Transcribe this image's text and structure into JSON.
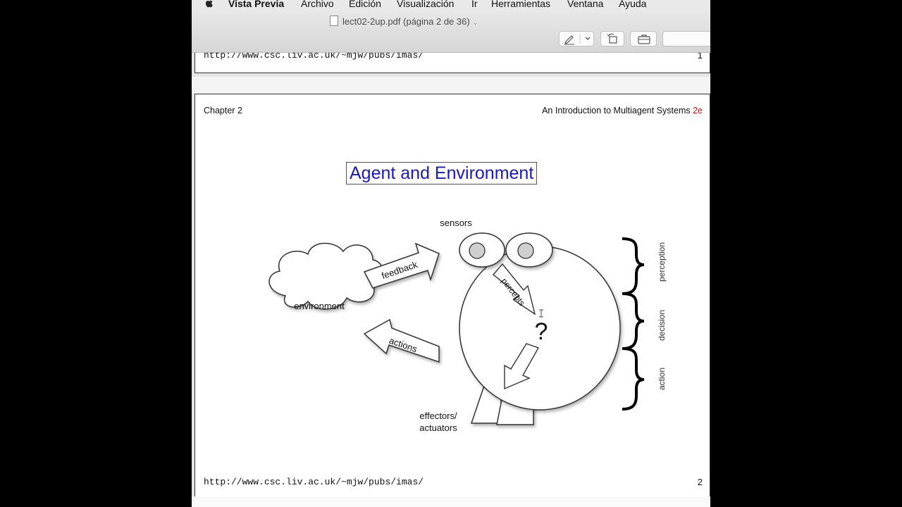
{
  "menubar": {
    "app_name": "Vista Previa",
    "items": [
      "Archivo",
      "Edición",
      "Visualización",
      "Ir",
      "Herramientas",
      "Ventana",
      "Ayuda"
    ]
  },
  "window": {
    "title": "lect02-2up.pdf (página 2 de 36)"
  },
  "page_prev": {
    "url": "http://www.csc.liv.ac.uk/~mjw/pubs/imas/",
    "page_number": "1"
  },
  "page": {
    "header_left": "Chapter 2",
    "header_right": "An Introduction to Multiagent Systems",
    "header_right_suffix": "2e",
    "title": "Agent and Environment",
    "url": "http://www.csc.liv.ac.uk/~mjw/pubs/imas/",
    "page_number": "2"
  },
  "diagram": {
    "sensors": "sensors",
    "environment": "environment",
    "feedback": "feedback",
    "actions": "actions",
    "percepts": "percepts",
    "question": "?",
    "effectors_line1": "effectors/",
    "effectors_line2": "actuators",
    "perception": "perception",
    "decision": "decision",
    "action": "action"
  },
  "colors": {
    "title_blue": "#1818c8",
    "accent_red": "#cc1111"
  }
}
